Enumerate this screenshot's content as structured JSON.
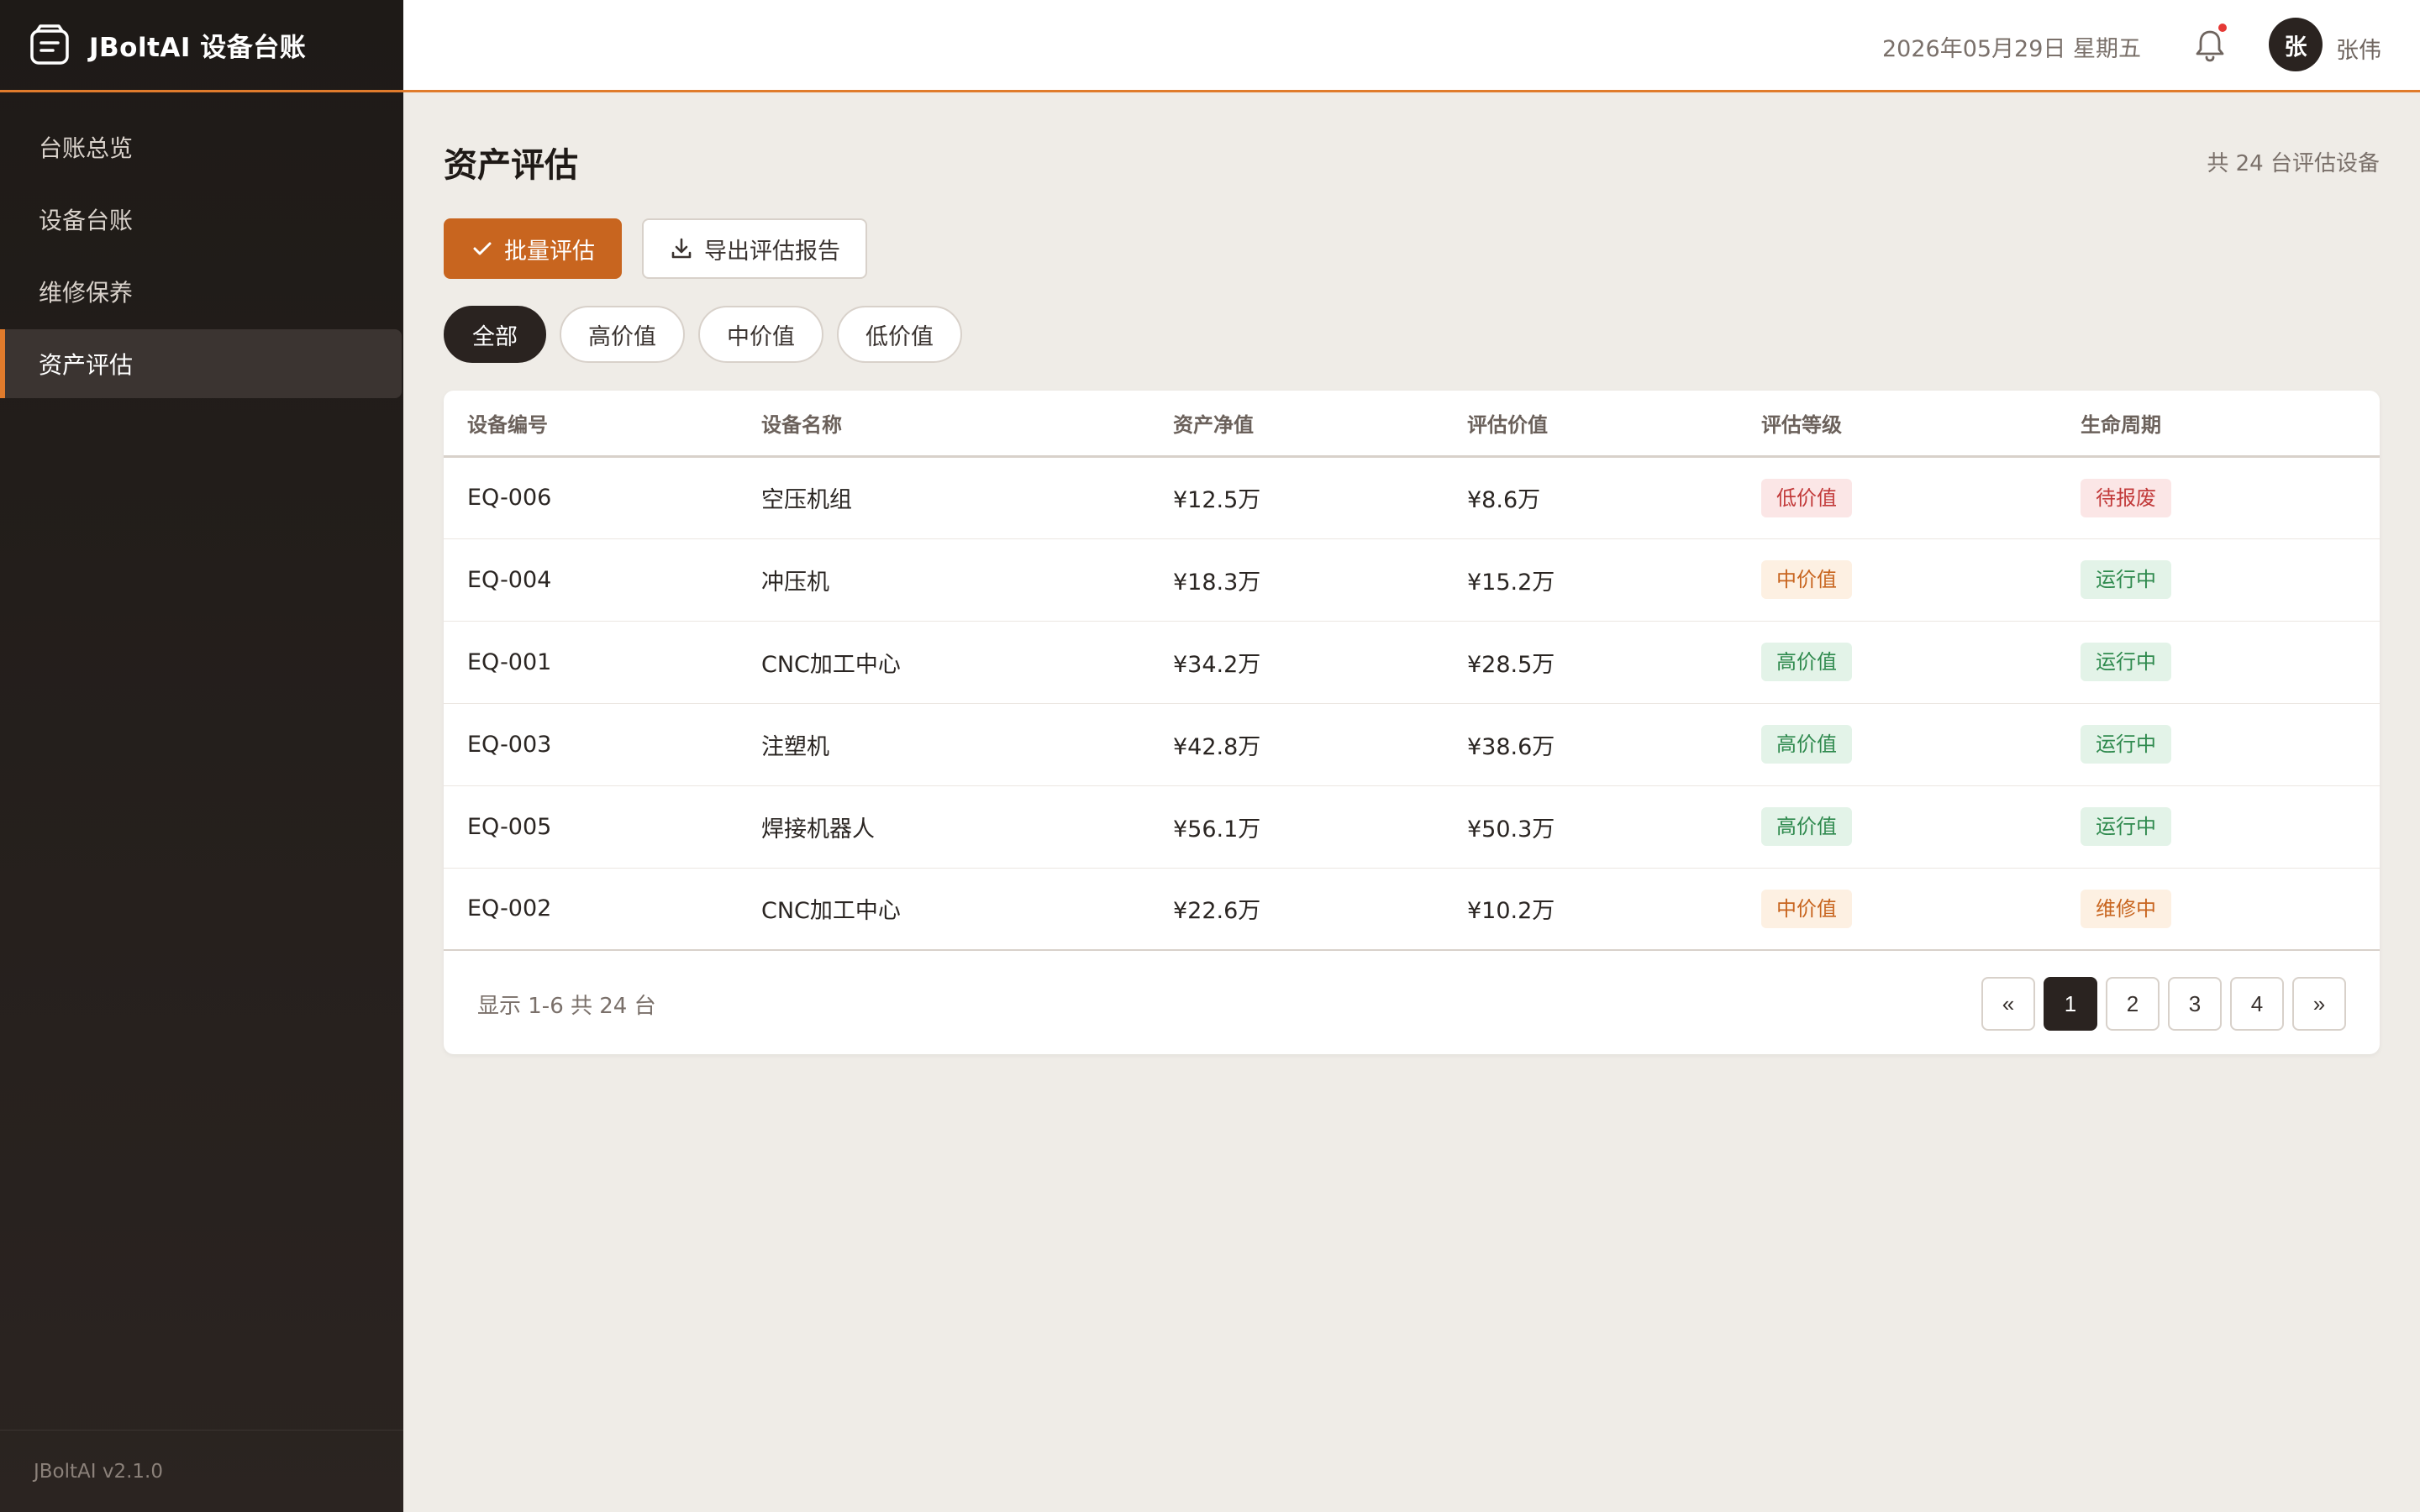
{
  "app": {
    "title": "JBoltAI 设备台账",
    "version": "JBoltAI v2.1.0"
  },
  "sidebar": {
    "items": [
      {
        "label": "台账总览",
        "active": false
      },
      {
        "label": "设备台账",
        "active": false
      },
      {
        "label": "维修保养",
        "active": false
      },
      {
        "label": "资产评估",
        "active": true
      }
    ]
  },
  "topbar": {
    "date": "2026年05月29日 星期五",
    "notification_icon": "bell-icon",
    "avatar_initial": "张",
    "user_name": "张伟"
  },
  "main": {
    "title": "资产评估",
    "total_label": "共 24 台评估设备",
    "actions": {
      "batch_label": "批量评估",
      "export_label": "导出评估报告"
    },
    "filters": [
      {
        "label": "全部",
        "active": true
      },
      {
        "label": "高价值",
        "active": false
      },
      {
        "label": "中价值",
        "active": false
      },
      {
        "label": "低价值",
        "active": false
      }
    ],
    "table": {
      "columns": [
        "设备编号",
        "设备名称",
        "资产净值",
        "评估价值",
        "评估等级",
        "生命周期"
      ],
      "rows": [
        {
          "id": "EQ-006",
          "name": "空压机组",
          "net": "¥12.5万",
          "eval": "¥8.6万",
          "grade": "低价值",
          "cycle": "待报废"
        },
        {
          "id": "EQ-004",
          "name": "冲压机",
          "net": "¥18.3万",
          "eval": "¥15.2万",
          "grade": "中价值",
          "cycle": "运行中"
        },
        {
          "id": "EQ-001",
          "name": "CNC加工中心",
          "net": "¥34.2万",
          "eval": "¥28.5万",
          "grade": "高价值",
          "cycle": "运行中"
        },
        {
          "id": "EQ-003",
          "name": "注塑机",
          "net": "¥42.8万",
          "eval": "¥38.6万",
          "grade": "高价值",
          "cycle": "运行中"
        },
        {
          "id": "EQ-005",
          "name": "焊接机器人",
          "net": "¥56.1万",
          "eval": "¥50.3万",
          "grade": "高价值",
          "cycle": "运行中"
        },
        {
          "id": "EQ-002",
          "name": "CNC加工中心",
          "net": "¥22.6万",
          "eval": "¥10.2万",
          "grade": "中价值",
          "cycle": "维修中"
        }
      ]
    },
    "footer": {
      "info": "显示 1-6 共 24 台"
    },
    "pagination": {
      "prev": "«",
      "pages": [
        "1",
        "2",
        "3",
        "4"
      ],
      "current": "1",
      "next": "»"
    }
  },
  "colors": {
    "accent": "#c8651f",
    "sidebar_bg": "#1e1a17",
    "dark": "#2a2320"
  }
}
